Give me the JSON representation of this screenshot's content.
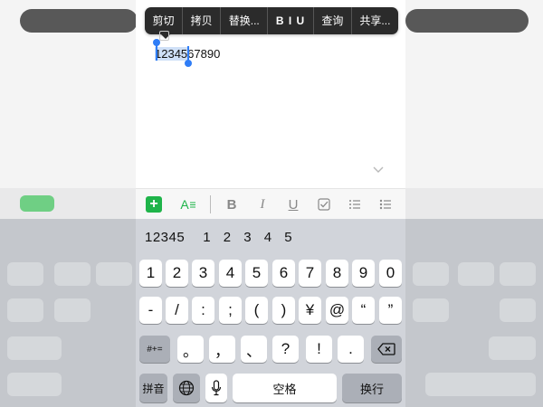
{
  "edit_menu": {
    "items": [
      "剪切",
      "拷贝",
      "替换...",
      "B I U",
      "查询",
      "共享..."
    ]
  },
  "document": {
    "text_selected": "12345",
    "text_rest": "67890"
  },
  "format_toolbar": {
    "add_icon": "plus-icon",
    "style_label": "A",
    "bold": "B",
    "italic": "I",
    "underline": "U"
  },
  "candidates": [
    "12345",
    "1 2 3 4 5"
  ],
  "keys": {
    "row1": [
      "1",
      "2",
      "3",
      "4",
      "5",
      "6",
      "7",
      "8",
      "9",
      "0"
    ],
    "row2": [
      "-",
      "/",
      ":",
      ";",
      "(",
      ")",
      "¥",
      "@",
      "“",
      "”"
    ],
    "row3_left": "#+=",
    "row3": [
      "。",
      "，",
      "、",
      "?",
      "!",
      "."
    ],
    "pinyin": "拼音",
    "space": "空格",
    "enter": "换行"
  },
  "colors": {
    "accent_green": "#1fb44a",
    "selection_blue": "#2f7df6"
  }
}
